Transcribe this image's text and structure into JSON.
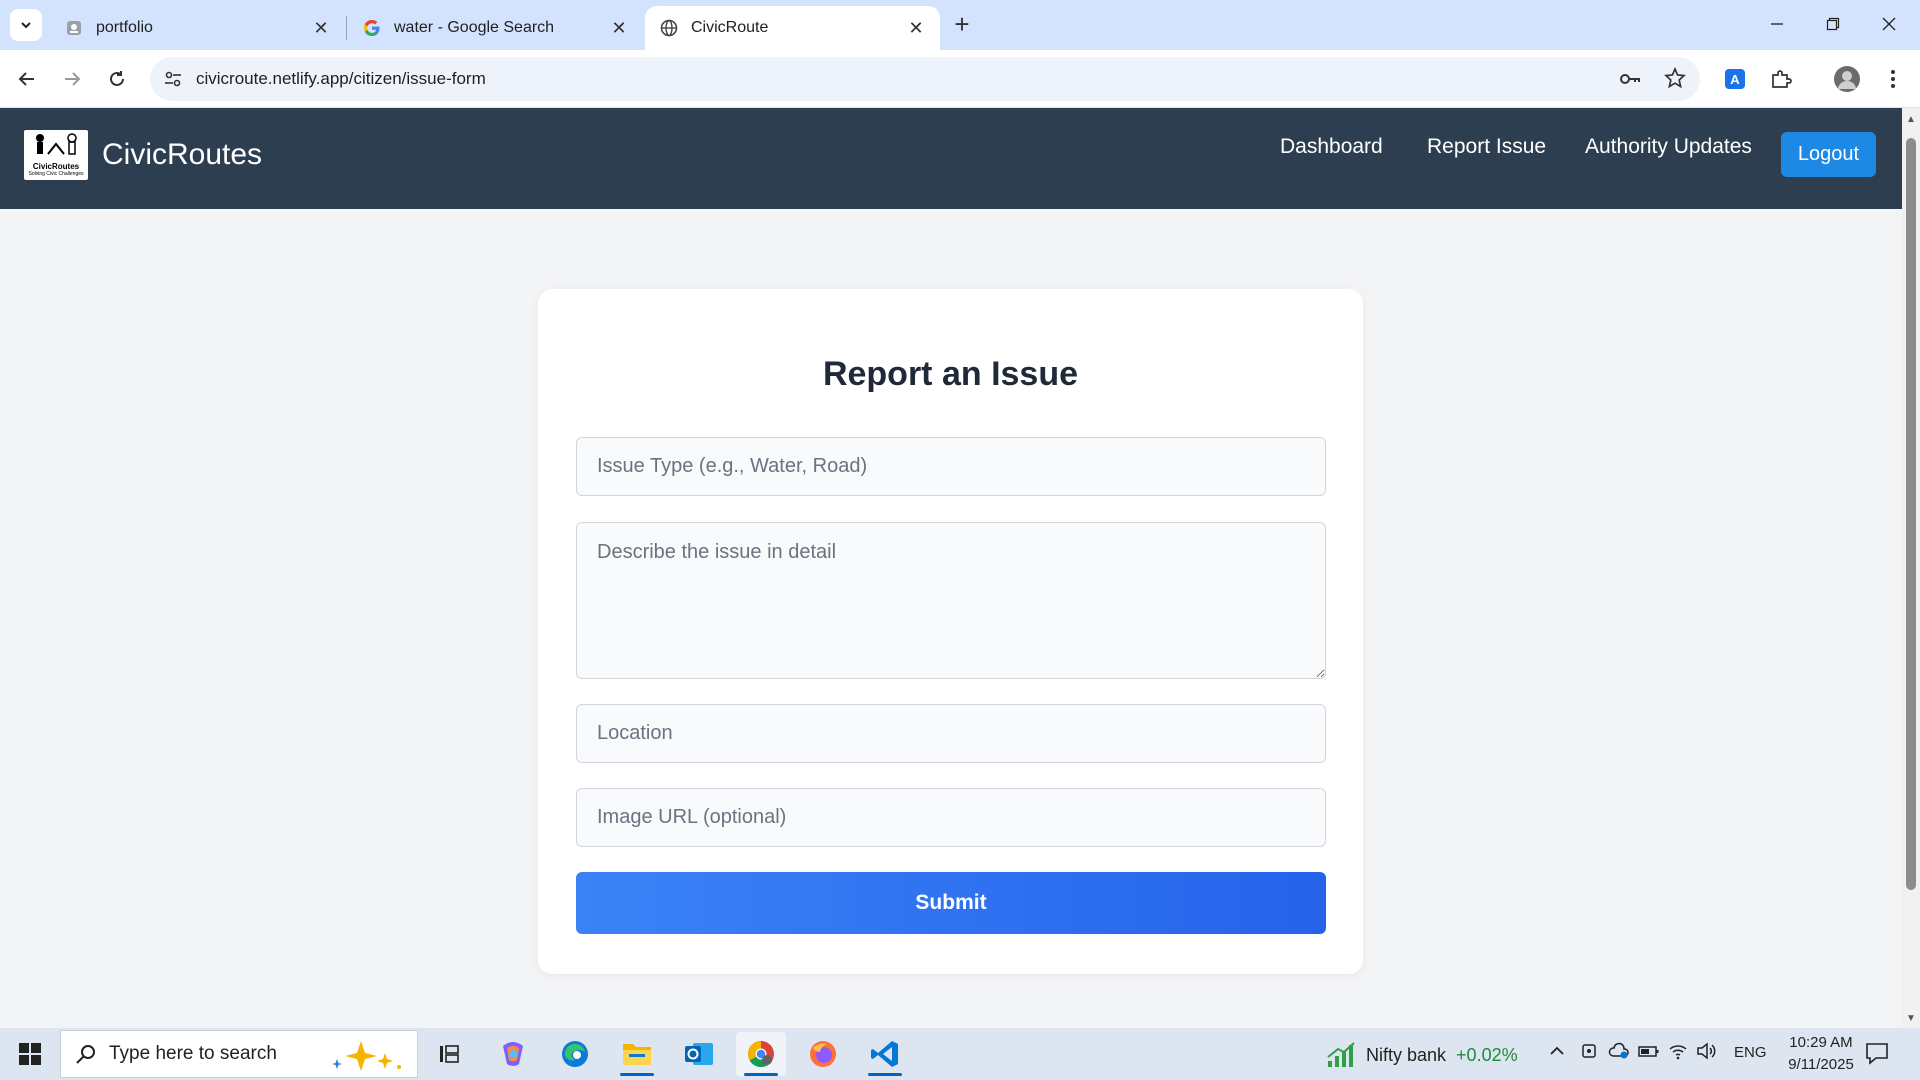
{
  "browser": {
    "tabs": [
      {
        "title": "portfolio",
        "favicon": "portfolio-favicon"
      },
      {
        "title": "water - Google Search",
        "favicon": "google-favicon"
      },
      {
        "title": "CivicRoute",
        "favicon": "globe-favicon",
        "active": true
      }
    ],
    "url": "civicroute.netlify.app/citizen/issue-form"
  },
  "app": {
    "logo_text": "CivicRoutes",
    "logo_subtext": "Solving Civic Challenges",
    "brand": "CivicRoutes",
    "nav": {
      "dashboard": "Dashboard",
      "report_issue": "Report Issue",
      "authority_updates": "Authority Updates",
      "logout": "Logout"
    },
    "colors": {
      "navbar": "#2c3e50",
      "accent": "#1e88e5",
      "submit": "#2563eb"
    }
  },
  "form": {
    "title": "Report an Issue",
    "issue_type_placeholder": "Issue Type (e.g., Water, Road)",
    "description_placeholder": "Describe the issue in detail",
    "location_placeholder": "Location",
    "image_url_placeholder": "Image URL (optional)",
    "submit_label": "Submit"
  },
  "taskbar": {
    "search_placeholder": "Type here to search",
    "stock_name": "Nifty bank",
    "stock_change": "+0.02%",
    "language": "ENG",
    "time": "10:29 AM",
    "date": "9/11/2025"
  }
}
